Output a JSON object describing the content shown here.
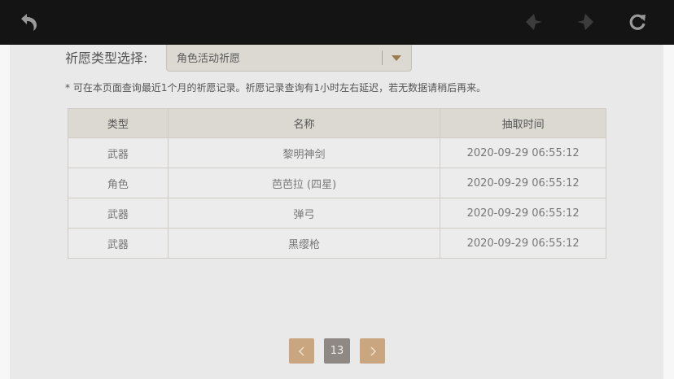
{
  "topbar": {
    "back_icon": "back-arrow-icon",
    "prev_icon": "diamond-left-icon",
    "next_icon": "diamond-right-icon",
    "refresh_icon": "refresh-icon"
  },
  "filter": {
    "label": "祈愿类型选择:",
    "selected": "角色活动祈愿",
    "arrow_icon": "chevron-down-icon"
  },
  "notice": "* 可在本页面查询最近1个月的祈愿记录。祈愿记录查询有1小时左右延迟，若无数据请稍后再来。",
  "table": {
    "headers": {
      "type": "类型",
      "name": "名称",
      "time": "抽取时间"
    },
    "rows": [
      {
        "type": "武器",
        "name": "黎明神剑",
        "time": "2020-09-29 06:55:12"
      },
      {
        "type": "角色",
        "name": "芭芭拉 (四星)",
        "time": "2020-09-29 06:55:12"
      },
      {
        "type": "武器",
        "name": "弹弓",
        "time": "2020-09-29 06:55:12"
      },
      {
        "type": "武器",
        "name": "黑缨枪",
        "time": "2020-09-29 06:55:12"
      }
    ]
  },
  "pagination": {
    "current_page": "13",
    "prev_icon": "chevron-left-icon",
    "next_icon": "chevron-right-icon"
  },
  "colors": {
    "topbar": "#141414",
    "accent_gold": "#c9a67f",
    "page_active": "#8f8985",
    "four_star_purple": "#9b55c2"
  }
}
